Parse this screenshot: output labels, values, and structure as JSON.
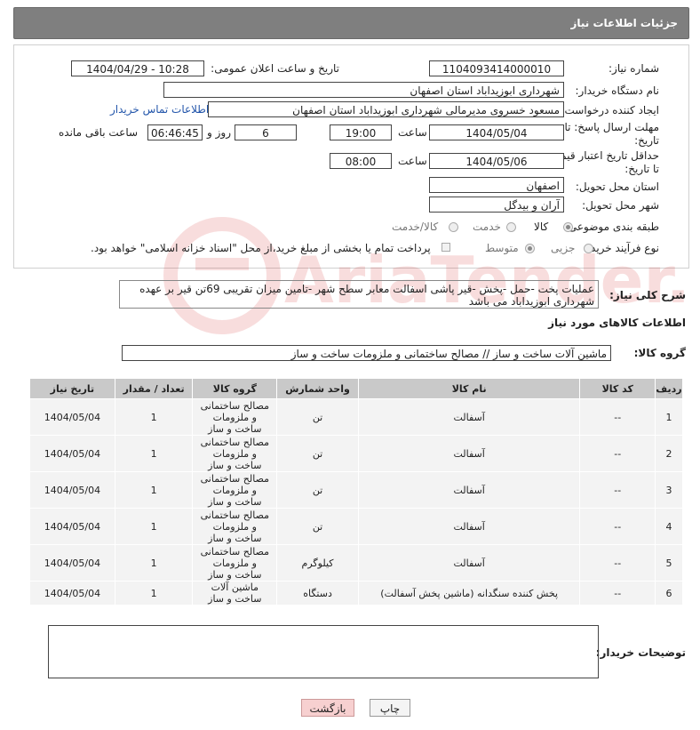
{
  "header": {
    "title": "جزئیات اطلاعات نیاز"
  },
  "form": {
    "need_number_label": "شماره نیاز:",
    "need_number": "1104093414000010",
    "announce_label": "تاریخ و ساعت اعلان عمومی:",
    "announce_value": "1404/04/29 - 10:28",
    "buyer_org_label": "نام دستگاه خریدار:",
    "buyer_org": "شهرداری ابوزیداباد استان اصفهان",
    "requester_label": "ایجاد کننده درخواست:",
    "requester": "مسعود خسروی مدیرمالی شهرداری ابوزیداباد استان اصفهان",
    "contact_link": "اطلاعات تماس خریدار",
    "deadline_label_1": "مهلت ارسال پاسخ: تا",
    "deadline_label_2": "تاریخ:",
    "deadline_date": "1404/05/04",
    "time_label": "ساعت",
    "deadline_time": "19:00",
    "days_value": "6",
    "days_label": "روز و",
    "remaining_time": "06:46:45",
    "remaining_label": "ساعت باقی مانده",
    "price_label_1": "حداقل تاریخ اعتبار قیمت:",
    "price_label_2": "تا تاریخ:",
    "price_date": "1404/05/06",
    "price_time": "08:00",
    "province_label": "استان محل تحویل:",
    "province": "اصفهان",
    "city_label": "شهر محل تحویل:",
    "city": "آران و بیدگل",
    "category_label": "طبقه بندی موضوعی:",
    "category_options": [
      "کالا",
      "خدمت",
      "کالا/خدمت"
    ],
    "process_label": "نوع فرآیند خرید :",
    "process_options": [
      "جزیی",
      "متوسط"
    ],
    "payment_note": "پرداخت تمام یا بخشی از مبلغ خرید،از محل \"اسناد خزانه اسلامی\" خواهد بود."
  },
  "description": {
    "label": "شرح کلی نیاز:",
    "text": "عملیات پخت -حمل -پخش -قیر پاشی اسفالت معابر سطح شهر -تامین میزان تقریبی 69تن قیر بر عهده شهرداری ابوزیداباد می باشد"
  },
  "goods": {
    "section_title": "اطلاعات کالاهای مورد نیاز",
    "group_label": "گروه کالا:",
    "group_value": "ماشین آلات ساخت و ساز // مصالح ساختمانی و ملزومات ساخت و ساز",
    "columns": [
      "ردیف",
      "کد کالا",
      "نام کالا",
      "واحد شمارش",
      "گروه کالا",
      "تعداد / مقدار",
      "تاریخ نیاز"
    ],
    "rows": [
      [
        "1",
        "--",
        "آسفالت",
        "تن",
        "مصالح ساختمانی و ملزومات ساخت و ساز",
        "1",
        "1404/05/04"
      ],
      [
        "2",
        "--",
        "آسفالت",
        "تن",
        "مصالح ساختمانی و ملزومات ساخت و ساز",
        "1",
        "1404/05/04"
      ],
      [
        "3",
        "--",
        "آسفالت",
        "تن",
        "مصالح ساختمانی و ملزومات ساخت و ساز",
        "1",
        "1404/05/04"
      ],
      [
        "4",
        "--",
        "آسفالت",
        "تن",
        "مصالح ساختمانی و ملزومات ساخت و ساز",
        "1",
        "1404/05/04"
      ],
      [
        "5",
        "--",
        "آسفالت",
        "کیلوگرم",
        "مصالح ساختمانی و ملزومات ساخت و ساز",
        "1",
        "1404/05/04"
      ],
      [
        "6",
        "--",
        "پخش کننده سنگدانه (ماشین پخش آسفالت)",
        "دستگاه",
        "ماشین آلات ساخت و ساز",
        "1",
        "1404/05/04"
      ]
    ]
  },
  "buyer_notes": {
    "label": "توضیحات خریدار:",
    "value": ""
  },
  "buttons": {
    "print": "چاپ",
    "back": "بازگشت"
  },
  "watermark": {
    "text": "AriaTender.neT"
  }
}
